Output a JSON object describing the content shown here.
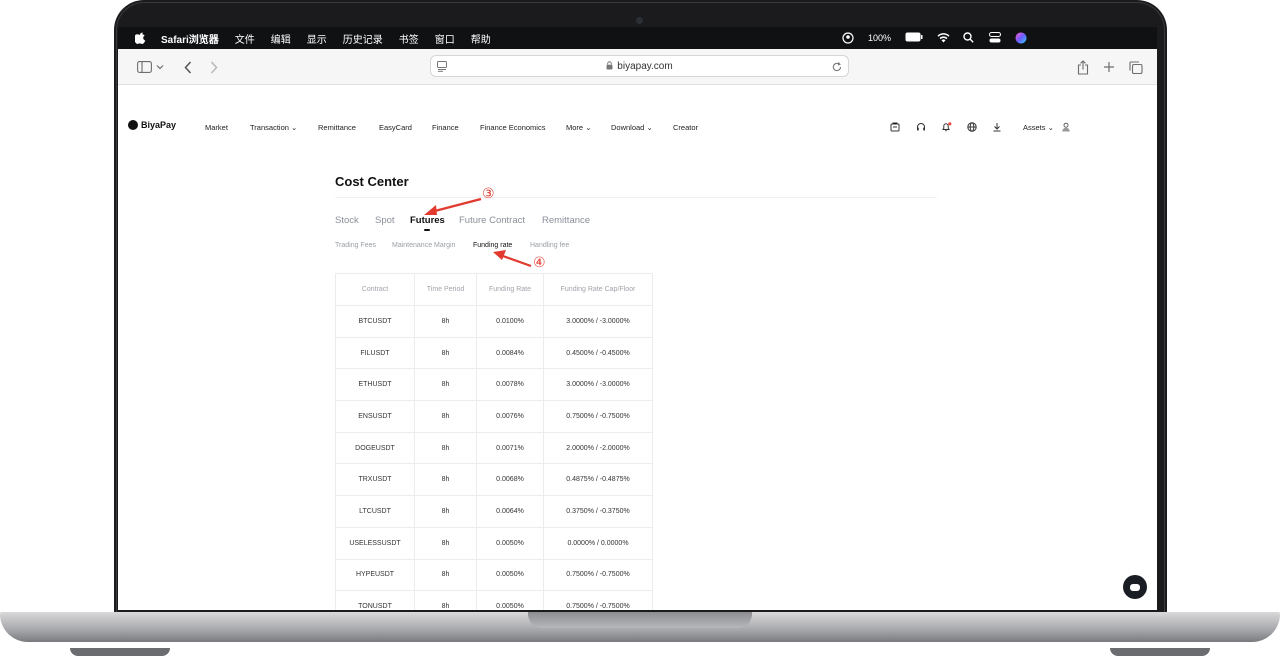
{
  "menubar": {
    "app_name": "Safari浏览器",
    "items": [
      "文件",
      "编辑",
      "显示",
      "历史记录",
      "书签",
      "窗口",
      "帮助"
    ],
    "battery": "100%"
  },
  "browser": {
    "url": "biyapay.com"
  },
  "nav": {
    "logo": "BiyaPay",
    "items": [
      "Market",
      "Transaction",
      "Remittance",
      "EasyCard",
      "Finance",
      "Finance Economics",
      "More",
      "Download",
      "Creator"
    ],
    "assets": "Assets"
  },
  "page": {
    "title": "Cost Center",
    "tabs": [
      "Stock",
      "Spot",
      "Futures",
      "Future Contract",
      "Remittance"
    ],
    "active_tab": "Futures",
    "subtabs": [
      "Trading Fees",
      "Maintenance Margin",
      "Funding rate",
      "Handling fee"
    ],
    "active_subtab": "Funding rate"
  },
  "table": {
    "headers": [
      "Contract",
      "Time Period",
      "Funding Rate",
      "Funding Rate Cap/Floor"
    ],
    "rows": [
      [
        "BTCUSDT",
        "8h",
        "0.0100%",
        "3.0000% / -3.0000%"
      ],
      [
        "FILUSDT",
        "8h",
        "0.0084%",
        "0.4500% / -0.4500%"
      ],
      [
        "ETHUSDT",
        "8h",
        "0.0078%",
        "3.0000% / -3.0000%"
      ],
      [
        "ENSUSDT",
        "8h",
        "0.0076%",
        "0.7500% / -0.7500%"
      ],
      [
        "DOGEUSDT",
        "8h",
        "0.0071%",
        "2.0000% / -2.0000%"
      ],
      [
        "TRXUSDT",
        "8h",
        "0.0068%",
        "0.4875% / -0.4875%"
      ],
      [
        "LTCUSDT",
        "8h",
        "0.0064%",
        "0.3750% / -0.3750%"
      ],
      [
        "USELESSUSDT",
        "8h",
        "0.0050%",
        "0.0000% / 0.0000%"
      ],
      [
        "HYPEUSDT",
        "8h",
        "0.0050%",
        "0.7500% / -0.7500%"
      ],
      [
        "TONUSDT",
        "8h",
        "0.0050%",
        "0.7500% / -0.7500%"
      ]
    ]
  },
  "annotations": {
    "step3": "③",
    "step4": "④",
    "color": "#e23a2f"
  }
}
